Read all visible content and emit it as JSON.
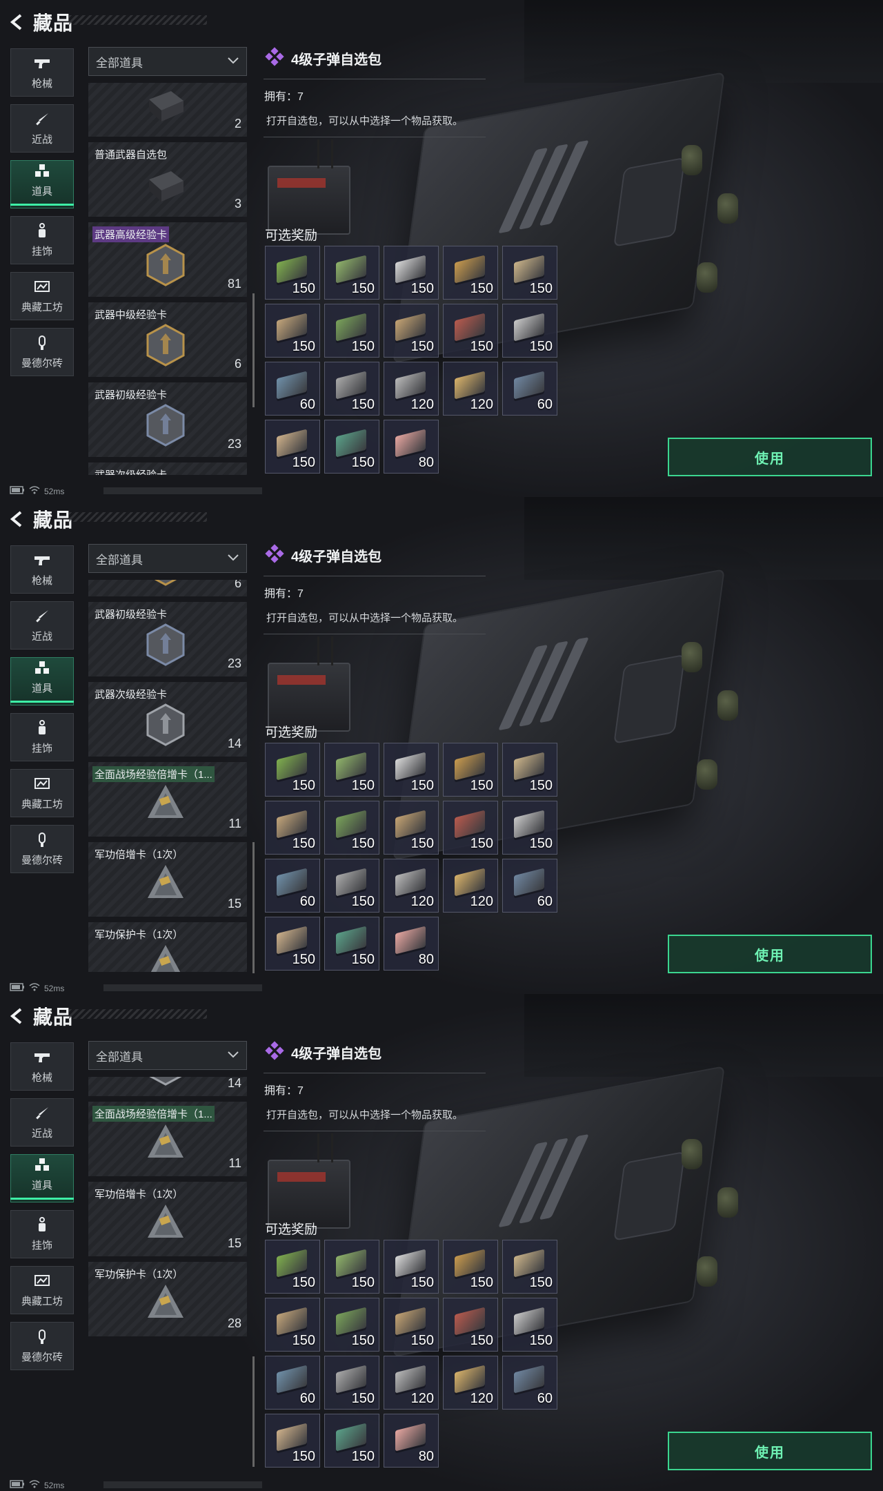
{
  "header": {
    "title": "藏品"
  },
  "nav": [
    {
      "label": "枪械",
      "icon": "pistol-icon",
      "active": false
    },
    {
      "label": "近战",
      "icon": "knife-icon",
      "active": false
    },
    {
      "label": "道具",
      "icon": "cubes-icon",
      "active": true
    },
    {
      "label": "挂饰",
      "icon": "charm-icon",
      "active": false
    },
    {
      "label": "典藏工坊",
      "icon": "workshop-icon",
      "active": false
    },
    {
      "label": "曼德尔砖",
      "icon": "brick-icon",
      "active": false
    }
  ],
  "filter": {
    "selected": "全部道具"
  },
  "items": [
    {
      "name": "",
      "count": "2",
      "tag": "none"
    },
    {
      "name": "普通武器自选包",
      "count": "3",
      "tag": "none"
    },
    {
      "name": "武器高级经验卡",
      "count": "81",
      "tag": "purple"
    },
    {
      "name": "武器中级经验卡",
      "count": "6",
      "tag": "none"
    },
    {
      "name": "武器初级经验卡",
      "count": "23",
      "tag": "none"
    },
    {
      "name": "武器次级经验卡",
      "count": "14",
      "tag": "none"
    },
    {
      "name": "全面战场经验倍增卡（1...",
      "count": "11",
      "tag": "green"
    },
    {
      "name": "军功倍增卡（1次）",
      "count": "15",
      "tag": "none"
    },
    {
      "name": "军功保护卡（1次）",
      "count": "28",
      "tag": "none"
    }
  ],
  "detail": {
    "title": "4级子弹自选包",
    "owned": "拥有：7",
    "description": "打开自选包，可以从中选择一个物品获取。",
    "rewards_label": "可选奖励",
    "rewards": [
      {
        "qty": "150",
        "color": "#7fae4e"
      },
      {
        "qty": "150",
        "color": "#8fb36a"
      },
      {
        "qty": "150",
        "color": "#d8d8d8"
      },
      {
        "qty": "150",
        "color": "#c89a4e"
      },
      {
        "qty": "150",
        "color": "#cbb48a"
      },
      {
        "qty": "150",
        "color": "#c2a47a"
      },
      {
        "qty": "150",
        "color": "#79a25a"
      },
      {
        "qty": "150",
        "color": "#c4a373"
      },
      {
        "qty": "150",
        "color": "#b85a4e"
      },
      {
        "qty": "150",
        "color": "#c8c8c8"
      },
      {
        "qty": "60",
        "color": "#6f8fa8"
      },
      {
        "qty": "150",
        "color": "#a9a9a9"
      },
      {
        "qty": "120",
        "color": "#b9b9b9"
      },
      {
        "qty": "120",
        "color": "#d8b26a"
      },
      {
        "qty": "60",
        "color": "#6f86a0"
      },
      {
        "qty": "150",
        "color": "#cdb08a"
      },
      {
        "qty": "150",
        "color": "#5aa088"
      },
      {
        "qty": "80",
        "color": "#e6a6a0"
      }
    ],
    "use_label": "使用"
  },
  "status": {
    "ping": "52ms"
  }
}
